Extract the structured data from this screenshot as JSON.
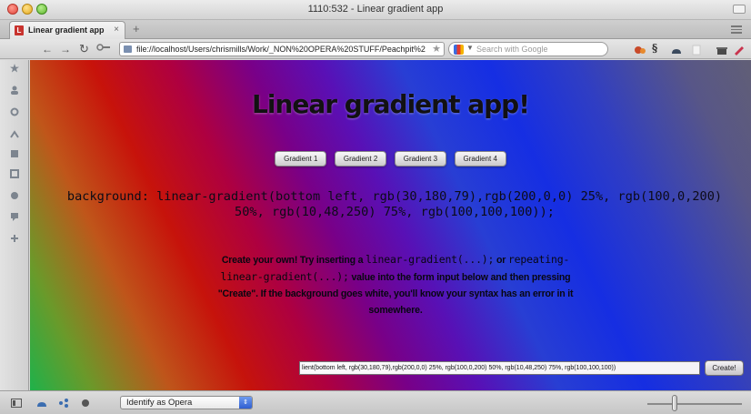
{
  "window": {
    "title": "1110:532 - Linear gradient app"
  },
  "tabs": [
    {
      "label": "Linear gradient app",
      "close": "×"
    }
  ],
  "new_tab": "+",
  "toolbar": {
    "back": "←",
    "forward": "→",
    "reload": "↻",
    "url": "file://localhost/Users/chrismills/Work/_NON%20OPERA%20STUFF/Peachpit%20bc",
    "bookmark_star": "★",
    "search_placeholder": "Search with Google",
    "search_dropdown": "▼",
    "extension_icon_label": "§"
  },
  "sidebar": {
    "icons": [
      "star-icon",
      "contacts-icon",
      "gear-icon",
      "history-icon",
      "notes-icon",
      "transfers-icon",
      "widgets-icon",
      "chat-icon",
      "add-panel-icon"
    ]
  },
  "page": {
    "title": "Linear gradient app!",
    "buttons": [
      "Gradient 1",
      "Gradient 2",
      "Gradient 3",
      "Gradient 4"
    ],
    "css_line1": "background: linear-gradient(bottom left, rgb(30,180,79),rgb(200,0,0) 25%, rgb(100,0,200)",
    "css_line2": "50%, rgb(10,48,250) 75%, rgb(100,100,100));",
    "instructions": {
      "part1": "Create your own! Try inserting a ",
      "code1": "linear-gradient(...);",
      "part2": " or ",
      "code2": "repeating-linear-gradient(...);",
      "part3": " value into the form input below and then pressing \"Create\". If the background goes white, you'll know your syntax has an error in it somewhere."
    },
    "input_value": "lient(bottom left, rgb(30,180,79),rgb(200,0,0) 25%, rgb(100,0,200) 50%, rgb(10,48,250) 75%, rgb(100,100,100))",
    "create_label": "Create!"
  },
  "statusbar": {
    "identify_as": "Identify as Opera",
    "select_arrows": "⇕"
  },
  "colors": {
    "gradient_stops": [
      "rgb(30,180,79)",
      "rgb(200,0,0)",
      "rgb(100,0,200)",
      "rgb(10,48,250)",
      "rgb(100,100,100)"
    ]
  }
}
